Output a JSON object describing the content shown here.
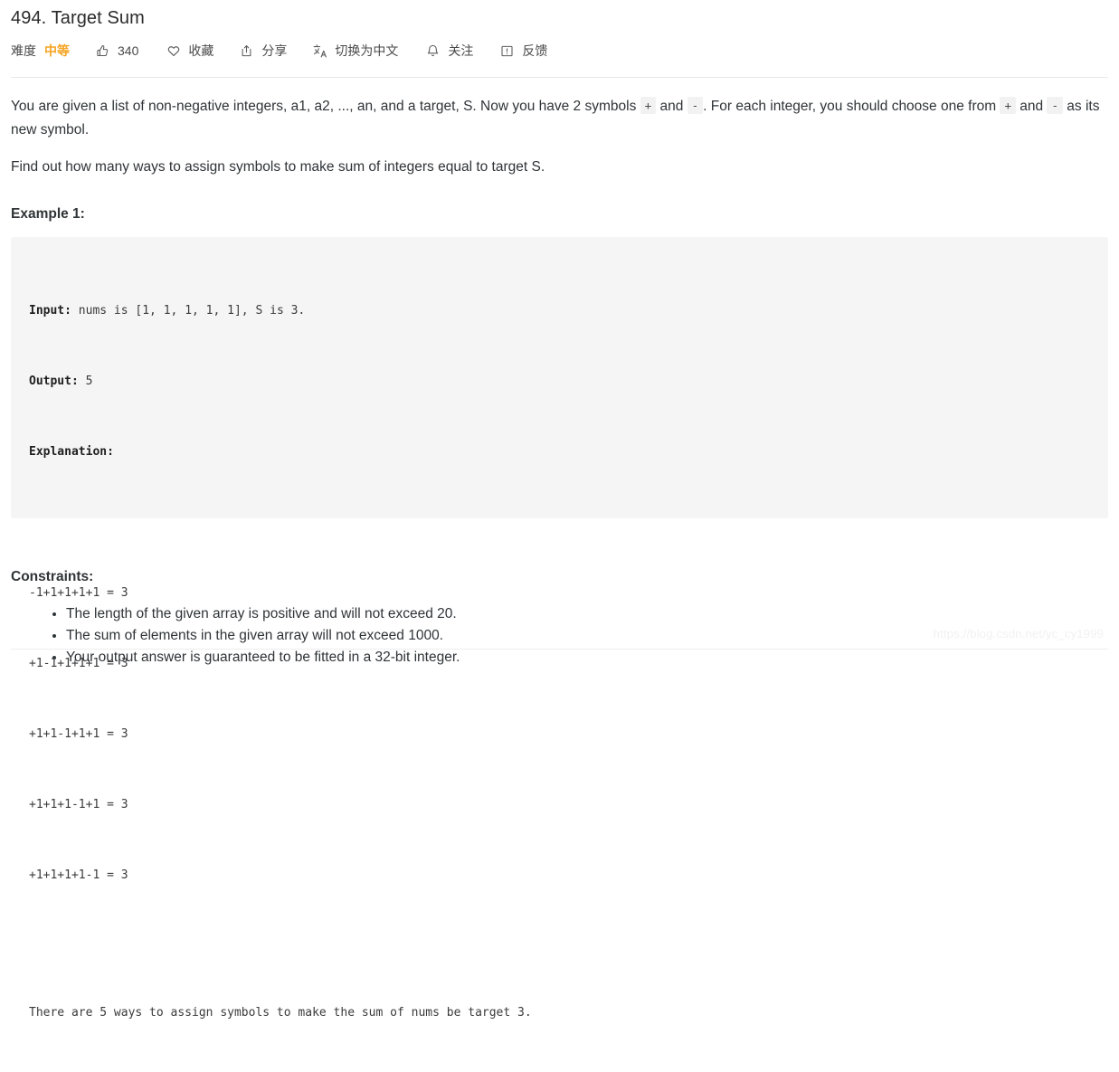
{
  "header": {
    "title": "494. Target Sum",
    "toolbar": {
      "difficulty_label": "难度",
      "difficulty_value": "中等",
      "difficulty_color": "#f5a524",
      "likes_count": "340",
      "favorite_label": "收藏",
      "share_label": "分享",
      "translate_label": "切换为中文",
      "follow_label": "关注",
      "feedback_label": "反馈"
    }
  },
  "content": {
    "paragraph_1_part_1": "You are given a list of non-negative integers, a1, a2, ..., an, and a target, S. Now you have 2 symbols ",
    "paragraph_1_code_1": "+",
    "paragraph_1_part_2": " and ",
    "paragraph_1_code_2": "-",
    "paragraph_1_part_3": ". For each integer, you should choose one from ",
    "paragraph_1_code_3": "+",
    "paragraph_1_part_4": " and ",
    "paragraph_1_code_4": "-",
    "paragraph_1_part_5": " as its new symbol.",
    "paragraph_2": "Find out how many ways to assign symbols to make sum of integers equal to target S.",
    "example_heading": "Example 1:",
    "example": {
      "input_key": "Input:",
      "input_value": " nums is [1, 1, 1, 1, 1], S is 3.",
      "output_key": "Output:",
      "output_value": " 5",
      "explanation_key": "Explanation:",
      "equations": [
        "-1+1+1+1+1 = 3",
        "+1-1+1+1+1 = 3",
        "+1+1-1+1+1 = 3",
        "+1+1+1-1+1 = 3",
        "+1+1+1+1-1 = 3"
      ],
      "summary": "There are 5 ways to assign symbols to make the sum of nums be target 3."
    },
    "constraints_heading": "Constraints:",
    "constraints": [
      "The length of the given array is positive and will not exceed 20.",
      "The sum of elements in the given array will not exceed 1000.",
      "Your output answer is guaranteed to be fitted in a 32-bit integer."
    ]
  },
  "watermark": "https://blog.csdn.net/yc_cy1999"
}
